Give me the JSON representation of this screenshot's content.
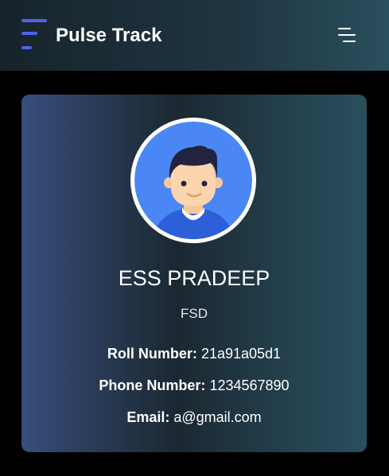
{
  "header": {
    "brand": "Pulse Track",
    "logo_icon": "bars-logo-icon",
    "menu_icon": "hamburger-menu-icon"
  },
  "profile": {
    "avatar_icon": "user-avatar-icon",
    "name": "ESS PRADEEP",
    "role": "FSD",
    "fields": [
      {
        "label": "Roll Number:",
        "value": "21a91a05d1"
      },
      {
        "label": "Phone Number:",
        "value": "1234567890"
      },
      {
        "label": "Email:",
        "value": "a@gmail.com"
      }
    ]
  },
  "colors": {
    "accent": "#4f63e8",
    "background": "#000000",
    "avatar_bg": "#4a87f5"
  }
}
